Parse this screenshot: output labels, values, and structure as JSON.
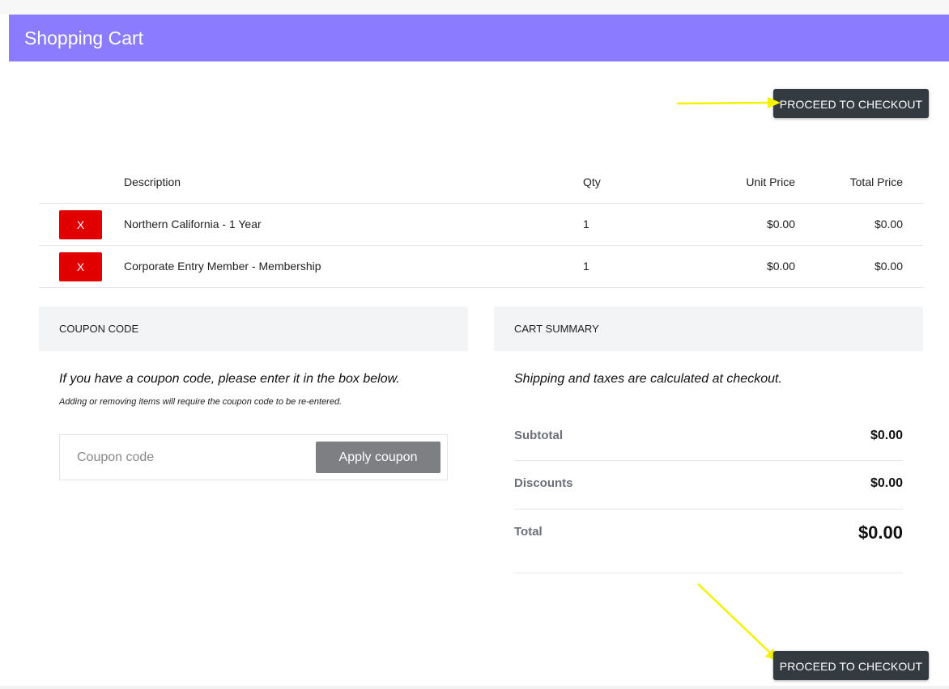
{
  "header": {
    "title": "Shopping Cart"
  },
  "checkout": {
    "label": "PROCEED TO CHECKOUT"
  },
  "table": {
    "columns": {
      "description": "Description",
      "qty": "Qty",
      "unit_price": "Unit Price",
      "total_price": "Total Price"
    },
    "remove_label": "X",
    "rows": [
      {
        "description": "Northern California - 1 Year",
        "qty": "1",
        "unit_price": "$0.00",
        "total_price": "$0.00"
      },
      {
        "description": "Corporate Entry Member - Membership",
        "qty": "1",
        "unit_price": "$0.00",
        "total_price": "$0.00"
      }
    ]
  },
  "coupon": {
    "heading": "COUPON CODE",
    "intro": "If you have a coupon code, please enter it in the box below.",
    "note": "Adding or removing items will require the coupon code to be re-entered.",
    "placeholder": "Coupon code",
    "value": "",
    "apply_label": "Apply coupon"
  },
  "summary": {
    "heading": "CART SUMMARY",
    "note": "Shipping and taxes are calculated at checkout.",
    "subtotal_label": "Subtotal",
    "subtotal_value": "$0.00",
    "discounts_label": "Discounts",
    "discounts_value": "$0.00",
    "total_label": "Total",
    "total_value": "$0.00"
  },
  "colors": {
    "header_bg": "#8a7bff",
    "checkout_bg": "#333a40",
    "remove_bg": "#e00000",
    "apply_bg": "#7d7f83",
    "annotation_arrow": "#f5f200"
  },
  "annotations": {
    "arrow_icon": "arrow-icon"
  }
}
